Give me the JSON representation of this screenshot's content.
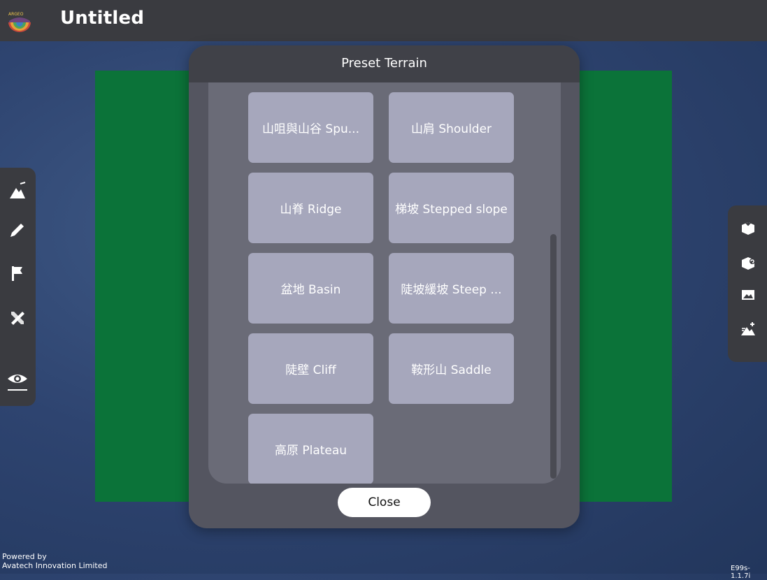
{
  "app": {
    "title": "Untitled",
    "logo_text": "ARGEO"
  },
  "left_toolbar": {
    "tools": [
      {
        "name": "terrain-tool",
        "icon": "mountain-plus-icon"
      },
      {
        "name": "draw-tool",
        "icon": "pencil-icon"
      },
      {
        "name": "flag-tool",
        "icon": "flag-icon"
      },
      {
        "name": "measure-tool",
        "icon": "ruler-pencil-icon"
      },
      {
        "name": "view-tool",
        "icon": "eye-icon"
      }
    ]
  },
  "right_toolbar": {
    "tools": [
      {
        "name": "box-import-tool",
        "icon": "box-down-icon"
      },
      {
        "name": "box-rotate-tool",
        "icon": "box-rotate-icon"
      },
      {
        "name": "image-tool",
        "icon": "image-icon"
      },
      {
        "name": "terrain-add-tool",
        "icon": "mountain-sparkle-icon"
      }
    ]
  },
  "modal": {
    "title": "Preset Terrain",
    "close_label": "Close",
    "presets": [
      {
        "label": "山咀與山谷 Spu..."
      },
      {
        "label": "山肩 Shoulder"
      },
      {
        "label": "山脊 Ridge"
      },
      {
        "label": "梯坡 Stepped slope"
      },
      {
        "label": "盆地 Basin"
      },
      {
        "label": "陡坡緩坡 Steep ..."
      },
      {
        "label": "陡壁 Cliff"
      },
      {
        "label": "鞍形山 Saddle"
      },
      {
        "label": "高原 Plateau"
      }
    ]
  },
  "footer": {
    "powered_line1": "Powered by",
    "powered_line2": "Avatech Innovation Limited",
    "version": "E99s-1.1.7i"
  },
  "colors": {
    "topbar": "#3a3b40",
    "canvas": "#0b7339",
    "tile": "#a6a7bc",
    "modal": "#545560"
  }
}
